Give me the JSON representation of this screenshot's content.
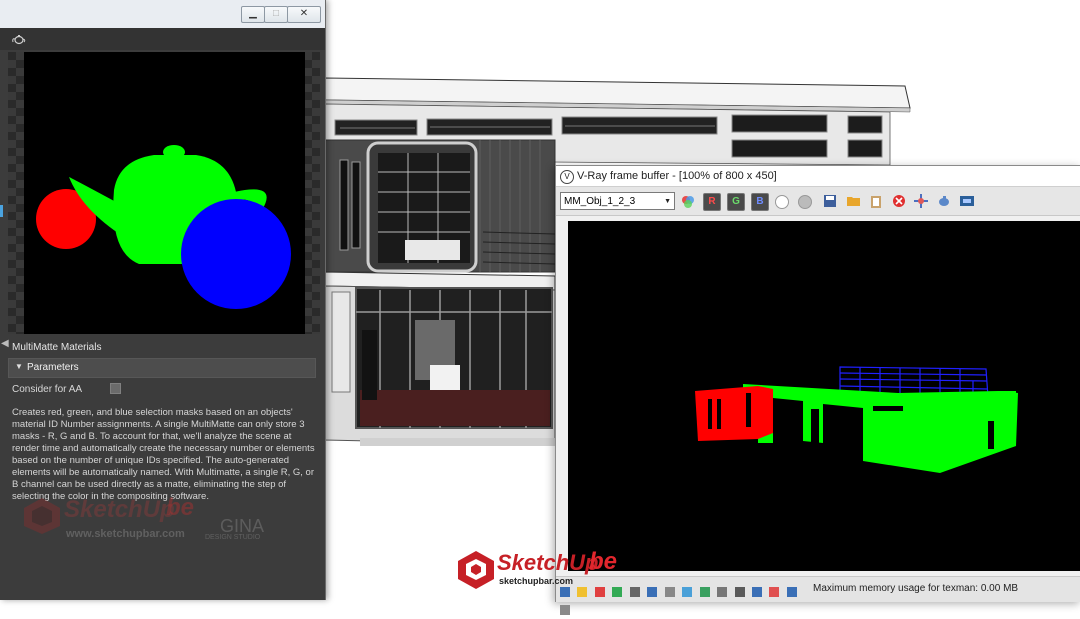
{
  "editor": {
    "window_buttons": {
      "minimize": "▁",
      "maximize": "□",
      "close": "✕"
    },
    "material_icon": "teapot-material-icon",
    "preview": {
      "teapot_color": "#00ff00",
      "left_sphere_color": "#ff0000",
      "right_sphere_color": "#0000ff"
    },
    "material_name": "MultiMatte Materials",
    "rollout": {
      "label": "Parameters"
    },
    "consider_aa_label": "Consider for AA",
    "consider_aa_checked": false,
    "description": "Creates red, green, and blue selection masks based on an objects' material ID Number assignments. A single MultiMatte can only store 3 masks - R, G and B. To account for that, we'll analyze the scene at render time and automatically create the necessary number or elements based on the number of unique IDs specified. The auto-generated elements will be automatically named. With Multimatte, a single R, G, or B channel can be used directly as a matte, eliminating the step of selecting the color in the compositing software.",
    "watermark": {
      "brand": "SketchUp",
      "brand_suffix": "be",
      "url": "www.sketchupbar.com",
      "studio": "GINA",
      "studio_sub": "DESIGN STUDIO"
    }
  },
  "vfb": {
    "title": "V-Ray frame buffer - [100% of 800 x 450]",
    "channel": "MM_Obj_1_2_3",
    "buttons": {
      "r": "R",
      "g": "G",
      "b": "B"
    },
    "status_text": "Maximum memory usage for texman: 0.00 MB",
    "colors": {
      "red": "#ff0000",
      "green": "#00ff00",
      "blue": "#2020ff"
    }
  },
  "watermark_bottom": {
    "brand": "SketchUp",
    "brand_suffix": "be",
    "url": "sketchupbar.com"
  }
}
